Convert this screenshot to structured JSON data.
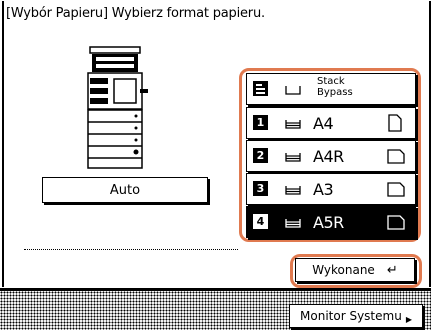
{
  "header": {
    "title": "[Wybór Papieru] Wybierz format papieru."
  },
  "auto_button": {
    "label": "Auto"
  },
  "trays": [
    {
      "id": "bypass",
      "line1": "Stack",
      "line2": "Bypass",
      "icon": "stack-bypass-icon"
    },
    {
      "id": "1",
      "number": "1",
      "size": "A4",
      "orientation": "portrait",
      "selected": false
    },
    {
      "id": "2",
      "number": "2",
      "size": "A4R",
      "orientation": "landscape",
      "selected": false
    },
    {
      "id": "3",
      "number": "3",
      "size": "A3",
      "orientation": "landscape",
      "selected": false
    },
    {
      "id": "4",
      "number": "4",
      "size": "A5R",
      "orientation": "landscape",
      "selected": true
    }
  ],
  "done_button": {
    "label": "Wykonane",
    "icon": "enter-arrow-icon"
  },
  "footer": {
    "system_monitor_label": "Monitor Systemu",
    "arrow_icon": "triangle-right-icon"
  },
  "colors": {
    "highlight": "#e07a50",
    "selected_bg": "#000000"
  }
}
